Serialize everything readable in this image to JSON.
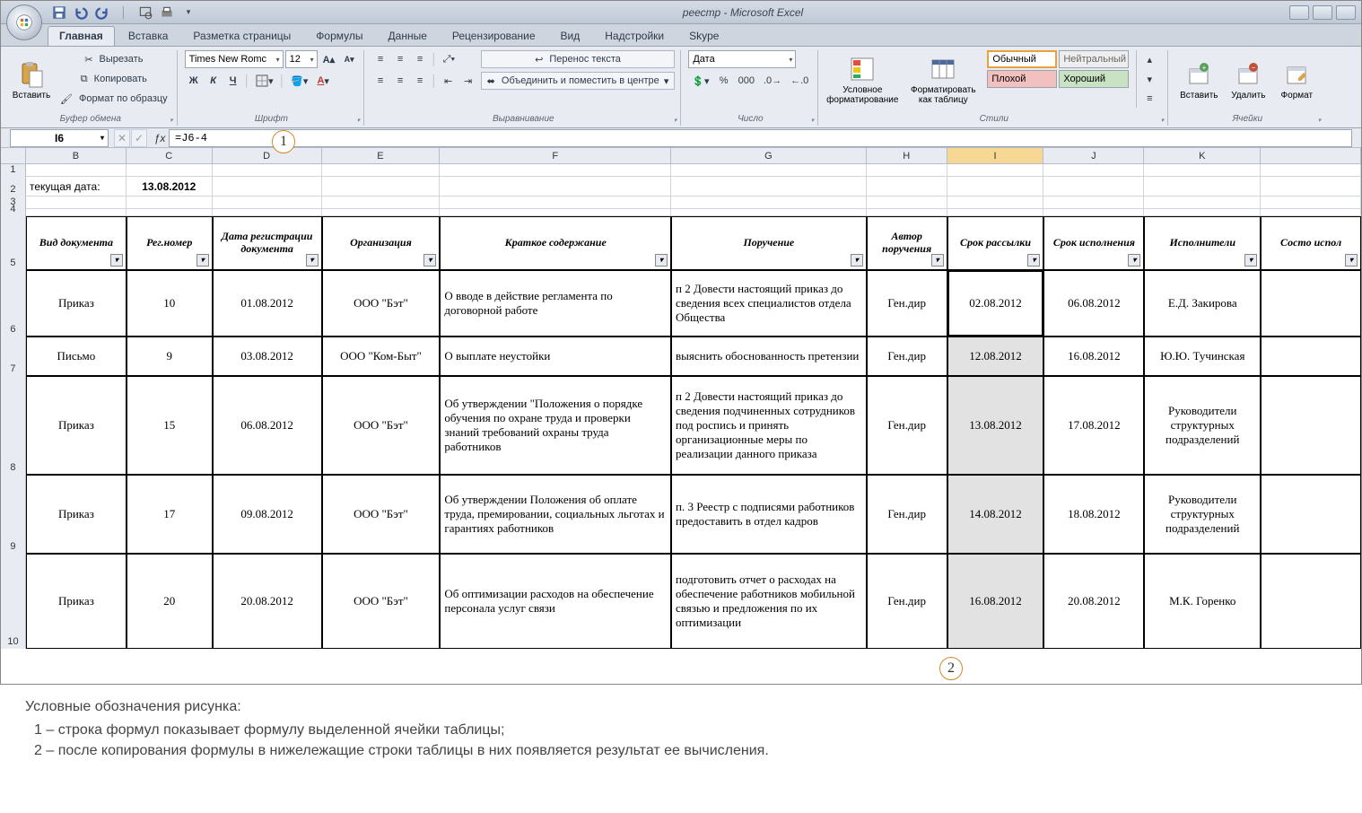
{
  "app": {
    "title": "реестр - Microsoft Excel"
  },
  "qat": {
    "save": "save-icon",
    "undo": "undo-icon",
    "redo": "redo-icon",
    "print": "print-icon",
    "preview": "preview-icon"
  },
  "tabs": [
    "Главная",
    "Вставка",
    "Разметка страницы",
    "Формулы",
    "Данные",
    "Рецензирование",
    "Вид",
    "Надстройки",
    "Skype"
  ],
  "ribbon": {
    "clipboard": {
      "paste": "Вставить",
      "cut": "Вырезать",
      "copy": "Копировать",
      "fmtpaint": "Формат по образцу",
      "label": "Буфер обмена"
    },
    "font": {
      "name_val": "Times New Romс",
      "size_val": "12",
      "bold": "Ж",
      "italic": "К",
      "underline": "Ч",
      "label": "Шрифт"
    },
    "align": {
      "wrap": "Перенос текста",
      "merge": "Объединить и поместить в центре",
      "label": "Выравнивание"
    },
    "number": {
      "fmt_val": "Дата",
      "label": "Число"
    },
    "styles": {
      "cond": "Условное форматирование",
      "astable": "Форматировать как таблицу",
      "normal": "Обычный",
      "neutral": "Нейтральный",
      "bad": "Плохой",
      "good": "Хороший",
      "label": "Стили"
    },
    "cells": {
      "insert": "Вставить",
      "delete": "Удалить",
      "format": "Формат",
      "label": "Ячейки"
    }
  },
  "formula_bar": {
    "cellref": "I6",
    "formula": "=J6-4"
  },
  "columns": [
    "B",
    "C",
    "D",
    "E",
    "F",
    "G",
    "H",
    "I",
    "J",
    "K"
  ],
  "row2": {
    "label": "текущая дата:",
    "value": "13.08.2012"
  },
  "table_headers": {
    "B": "Вид документа",
    "C": "Рег.номер",
    "D": "Дата регистрации документа",
    "E": "Организация",
    "F": "Краткое содержание",
    "G": "Поручение",
    "H": "Автор поручения",
    "I": "Срок рассылки",
    "J": "Срок исполнения",
    "K": "Исполнители",
    "L": "Состо испол"
  },
  "table_rows": [
    {
      "rn": 6,
      "B": "Приказ",
      "C": "10",
      "D": "01.08.2012",
      "E": "ООО \"Бэт\"",
      "F": "О вводе в действие регламента по договорной работе",
      "G": "п 2 Довести настоящий приказ до сведения всех специалистов отдела Общества",
      "H": "Ген.дир",
      "I": "02.08.2012",
      "J": "06.08.2012",
      "K": "Е.Д. Закирова",
      "I_shade": false,
      "I_sel": true
    },
    {
      "rn": 7,
      "B": "Письмо",
      "C": "9",
      "D": "03.08.2012",
      "E": "ООО \"Ком-Быт\"",
      "F": "О выплате неустойки",
      "G": "выяснить обоснованность претензии",
      "H": "Ген.дир",
      "I": "12.08.2012",
      "J": "16.08.2012",
      "K": "Ю.Ю. Тучинская",
      "I_shade": true
    },
    {
      "rn": 8,
      "B": "Приказ",
      "C": "15",
      "D": "06.08.2012",
      "E": "ООО \"Бэт\"",
      "F": "Об утверждении \"Положения о порядке обучения по охране труда и проверки знаний требований охраны труда работников",
      "G": "п 2 Довести настоящий приказ до сведения подчиненных сотрудников под роспись и принять организационные меры по реализации данного приказа",
      "H": "Ген.дир",
      "I": "13.08.2012",
      "J": "17.08.2012",
      "K": "Руководители структурных подразделений",
      "I_shade": true
    },
    {
      "rn": 9,
      "B": "Приказ",
      "C": "17",
      "D": "09.08.2012",
      "E": "ООО \"Бэт\"",
      "F": "Об утверждении Положения об оплате труда, премировании, социальных льготах и гарантиях работников",
      "G": "п. 3 Реестр с подписями работников предоставить в отдел кадров",
      "H": "Ген.дир",
      "I": "14.08.2012",
      "J": "18.08.2012",
      "K": "Руководители структурных подразделений",
      "I_shade": true
    },
    {
      "rn": 10,
      "B": "Приказ",
      "C": "20",
      "D": "20.08.2012",
      "E": "ООО \"Бэт\"",
      "F": "Об оптимизации расходов на обеспечение персонала услуг связи",
      "G": "подготовить отчет о расходах на обеспечение работников мобильной связью и предложения по их оптимизации",
      "H": "Ген.дир",
      "I": "16.08.2012",
      "J": "20.08.2012",
      "K": "М.К. Горенко",
      "I_shade": true
    }
  ],
  "callouts": {
    "c1": "1",
    "c2": "2"
  },
  "legend": {
    "title": "Условные обозначения рисунка:",
    "l1": "1 –  строка формул показывает формулу выделенной ячейки таблицы;",
    "l2": "2 –  после копирования формулы в нижележащие строки таблицы в них появляется результат ее вычисления."
  }
}
